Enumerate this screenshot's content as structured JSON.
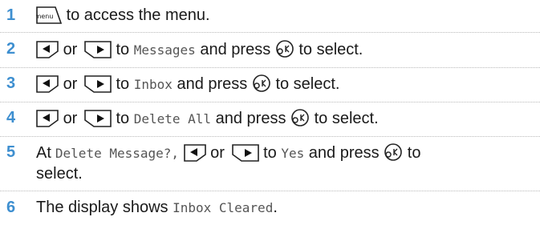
{
  "steps": [
    {
      "num": "1",
      "text": "to access the menu.",
      "menu_key_label": "menu"
    },
    {
      "num": "2",
      "or": "or",
      "to": "to",
      "target": "Messages",
      "press": "and press",
      "tail": "to select."
    },
    {
      "num": "3",
      "or": "or",
      "to": "to",
      "target": "Inbox",
      "press": "and press",
      "tail": "to select."
    },
    {
      "num": "4",
      "or": "or",
      "to": "to",
      "target": "Delete All",
      "press": "and press",
      "tail": "to select."
    },
    {
      "num": "5",
      "prefix": "At",
      "prompt": "Delete Message?,",
      "or": "or",
      "to": "to",
      "target": "Yes",
      "press": "and press",
      "tail_a": "to",
      "tail_b": "select."
    },
    {
      "num": "6",
      "text": "The display shows",
      "target": "Inbox Cleared",
      "end": "."
    }
  ],
  "icons": {
    "menu_key": "menu-key-icon",
    "left_key": "left-arrow-key-icon",
    "right_key": "right-arrow-key-icon",
    "ok_key": "ok-key-icon"
  },
  "colors": {
    "step_number": "#3e8fd0",
    "separator": "#b9b9b9",
    "mono_text": "#555555"
  }
}
